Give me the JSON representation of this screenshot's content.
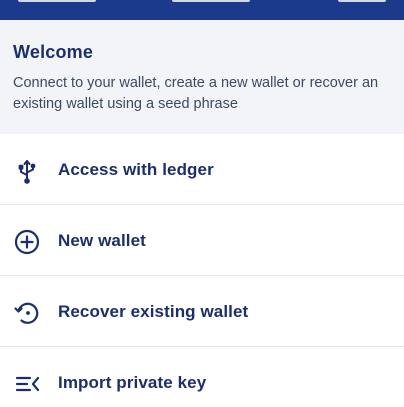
{
  "welcome": {
    "title": "Welcome",
    "description": "Connect to your wallet, create a new wallet or recover an existing wallet using a seed phrase"
  },
  "menu": {
    "items": [
      {
        "label": "Access with ledger",
        "icon": "usb-icon"
      },
      {
        "label": "New wallet",
        "icon": "plus-circle-icon"
      },
      {
        "label": "Recover existing wallet",
        "icon": "restore-icon"
      },
      {
        "label": "Import private key",
        "icon": "import-key-icon"
      }
    ]
  },
  "colors": {
    "header_bar": "#1b3a8c",
    "welcome_bg": "#f2f4f8",
    "text_primary": "#1b2f6b",
    "text_secondary": "#3b4a63",
    "divider": "#e6e8ee"
  }
}
